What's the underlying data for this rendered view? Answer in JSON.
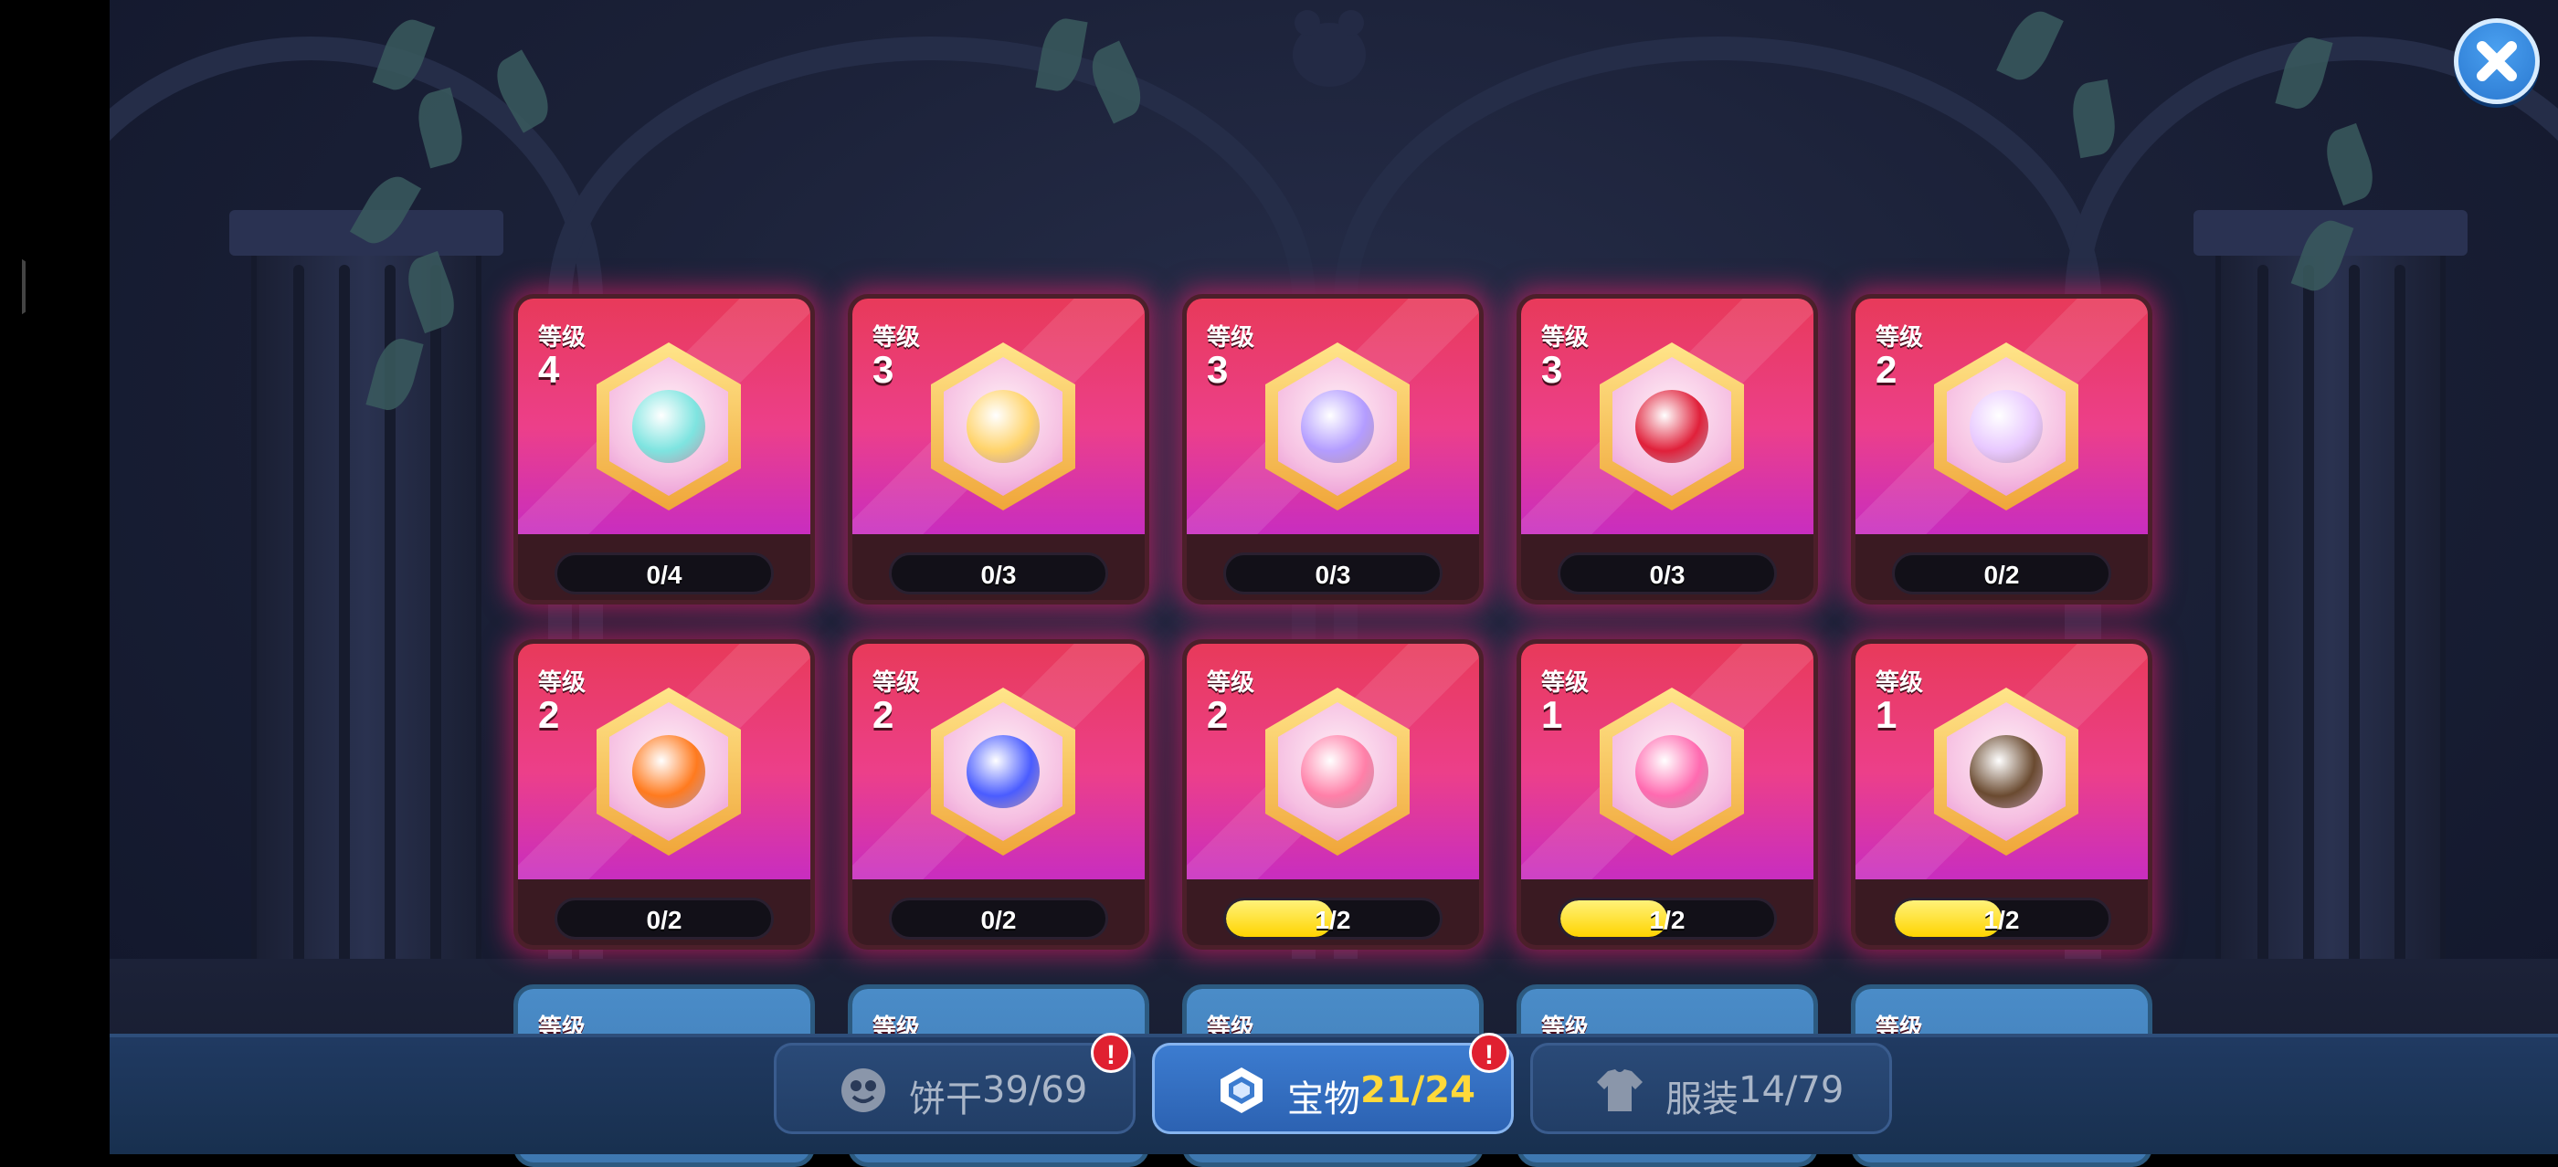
{
  "level_label": "等级",
  "treasures": [
    {
      "level": "4",
      "progress_text": "0/4",
      "progress": 0.0,
      "item": "crystal-branch-icon",
      "color": "#7ee4e0"
    },
    {
      "level": "3",
      "progress_text": "0/3",
      "progress": 0.0,
      "item": "flower-wreath-icon",
      "color": "#ffd36a"
    },
    {
      "level": "3",
      "progress_text": "0/3",
      "progress": 0.0,
      "item": "pocket-watch-icon",
      "color": "#b39cff"
    },
    {
      "level": "3",
      "progress_text": "0/3",
      "progress": 0.0,
      "item": "holly-berry-icon",
      "color": "#e0203a"
    },
    {
      "level": "2",
      "progress_text": "0/2",
      "progress": 0.0,
      "item": "lace-charm-icon",
      "color": "#e8c8ff"
    },
    {
      "level": "2",
      "progress_text": "0/2",
      "progress": 0.0,
      "item": "flame-crown-icon",
      "color": "#ff7a1e"
    },
    {
      "level": "2",
      "progress_text": "0/2",
      "progress": 0.0,
      "item": "blue-gem-icon",
      "color": "#4a5cff"
    },
    {
      "level": "2",
      "progress_text": "1/2",
      "progress": 0.5,
      "item": "pink-flamingo-icon",
      "color": "#ff7fa8"
    },
    {
      "level": "1",
      "progress_text": "1/2",
      "progress": 0.5,
      "item": "cat-balloon-icon",
      "color": "#ff6ab0"
    },
    {
      "level": "1",
      "progress_text": "1/2",
      "progress": 0.5,
      "item": "coconut-drum-icon",
      "color": "#6a4a30"
    }
  ],
  "tabs": {
    "cookies": {
      "label": "饼干",
      "count": "39/69",
      "icon": "cookie-face-icon",
      "alert": "!"
    },
    "treasures": {
      "label": "宝物",
      "count": "21/24",
      "icon": "hexagon-gem-icon",
      "alert": "!"
    },
    "costumes": {
      "label": "服装",
      "count": "14/79",
      "icon": "shirt-icon"
    }
  },
  "close_icon": "close-icon",
  "colors": {
    "card_glow": "#ff1e6e",
    "progress_fill": "#ffd400",
    "active_tab": "#3c7cd0",
    "count_highlight": "#ffd93a",
    "alert_badge": "#e02030"
  }
}
